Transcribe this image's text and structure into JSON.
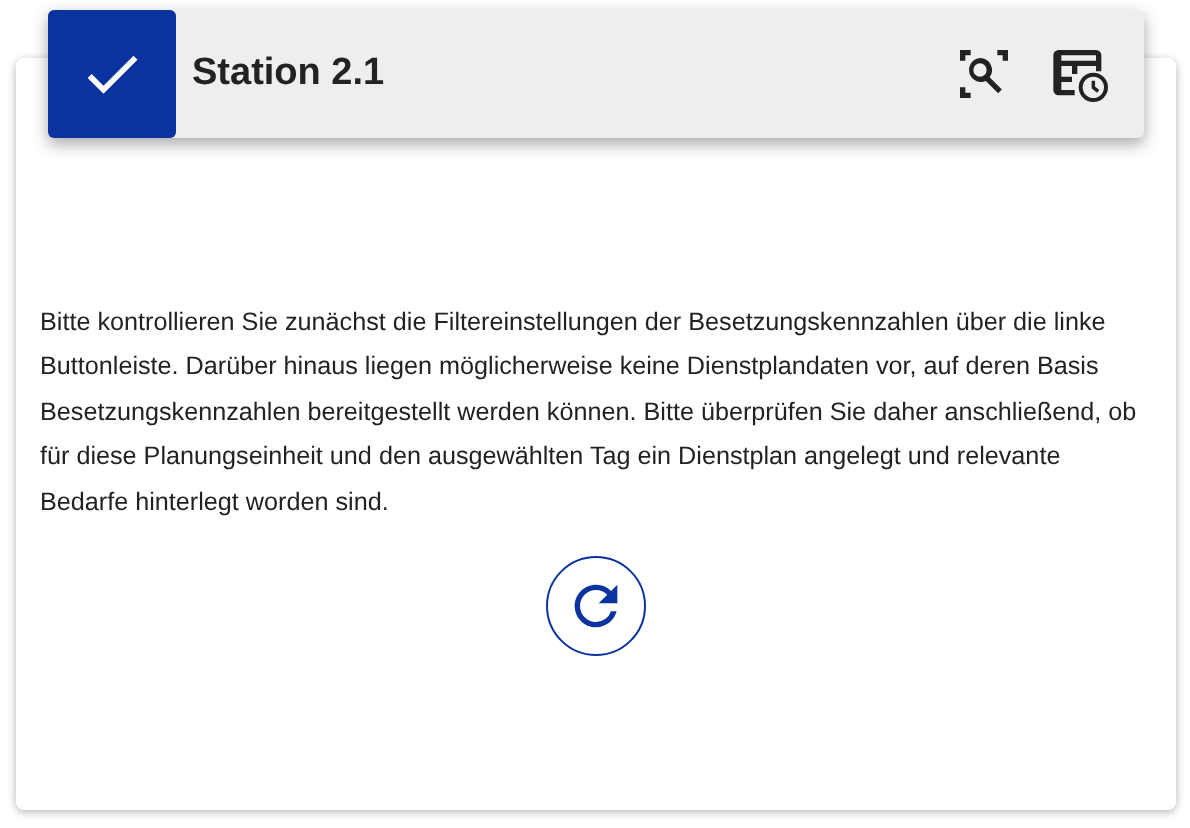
{
  "header": {
    "checked": true,
    "title": "Station 2.1"
  },
  "message": "Bitte kontrollieren Sie zunächst die Filtereinstellungen der Besetzungskennzahlen über die linke Buttonleiste. Darüber hinaus liegen möglicherweise keine Dienstplandaten vor, auf deren Basis Besetzungskennzahlen bereitgestellt werden können. Bitte überprüfen Sie daher anschließend, ob für diese Planungseinheit und den ausgewählten Tag ein Dienstplan angelegt und relevante Bedarfe hinterlegt worden sind."
}
